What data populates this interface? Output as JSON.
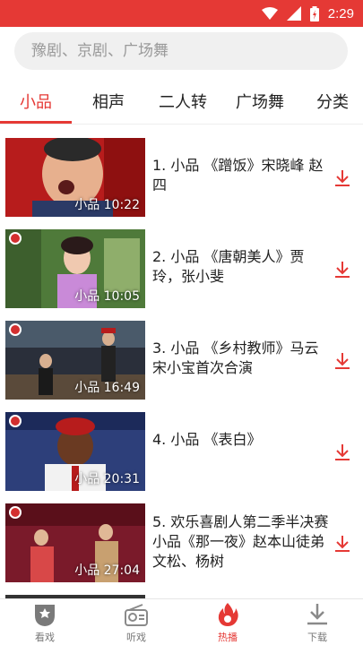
{
  "status": {
    "time": "2:29"
  },
  "search": {
    "placeholder": "豫剧、京剧、广场舞"
  },
  "tabs": [
    {
      "label": "小品"
    },
    {
      "label": "相声"
    },
    {
      "label": "二人转"
    },
    {
      "label": "广场舞"
    },
    {
      "label": "分类"
    }
  ],
  "items": [
    {
      "title": "1. 小品 《蹭饭》宋晓峰 赵四",
      "badge": "小品 10:22"
    },
    {
      "title": "2. 小品 《唐朝美人》贾玲，张小斐",
      "badge": "小品 10:05"
    },
    {
      "title": "3. 小品 《乡村教师》马云宋小宝首次合演",
      "badge": "小品 16:49"
    },
    {
      "title": "4. 小品 《表白》",
      "badge": "小品 20:31"
    },
    {
      "title": "5. 欢乐喜剧人第二季半决赛小品《那一夜》赵本山徒弟文松、杨树",
      "badge": "小品 27:04"
    }
  ],
  "nav": [
    {
      "label": "看戏",
      "icon": "opera-mask-icon"
    },
    {
      "label": "听戏",
      "icon": "radio-icon"
    },
    {
      "label": "热播",
      "icon": "flame-icon"
    },
    {
      "label": "下载",
      "icon": "download-icon"
    }
  ],
  "colors": {
    "accent": "#e53935"
  }
}
